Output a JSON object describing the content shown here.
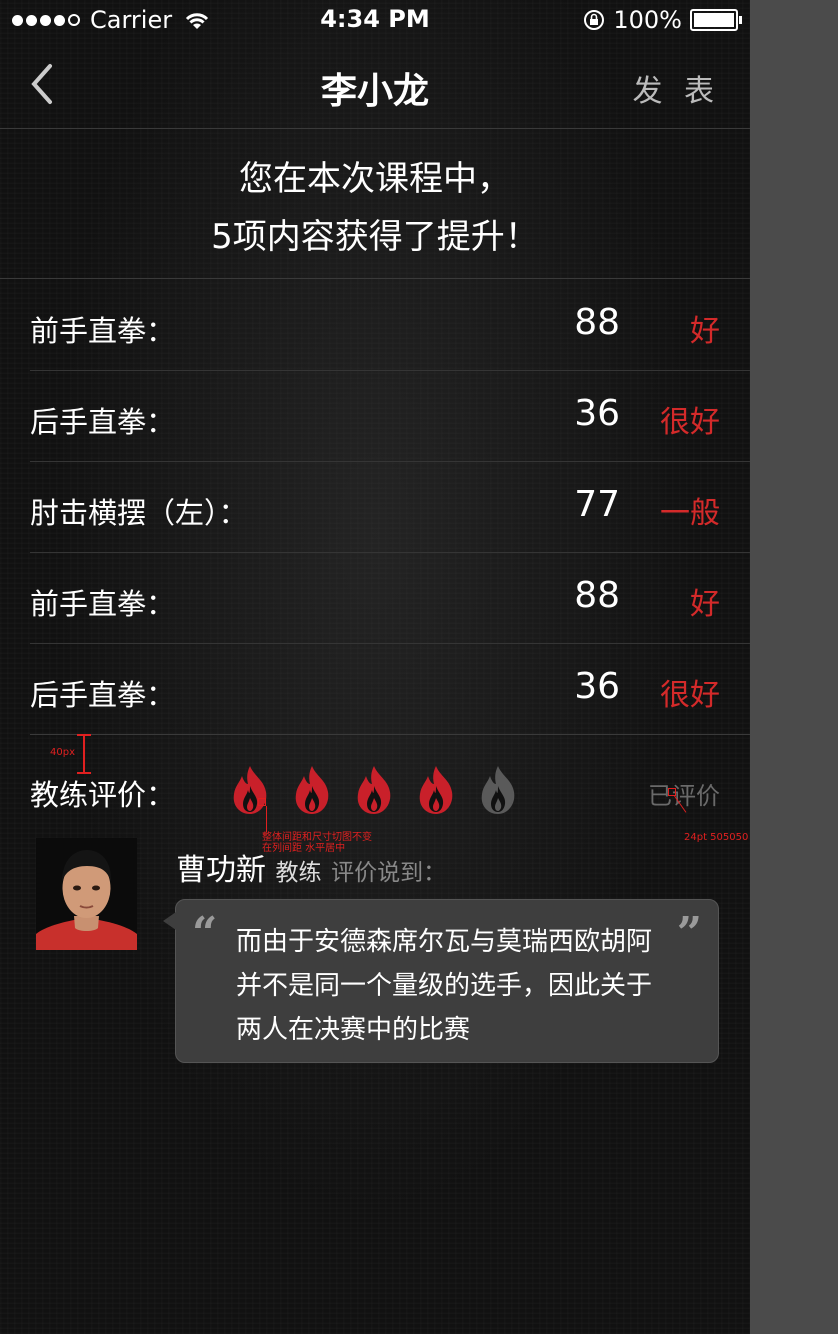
{
  "status_bar": {
    "carrier": "Carrier",
    "time": "4:34 PM",
    "battery": "100%"
  },
  "nav": {
    "title": "李小龙",
    "publish_label": "发 表"
  },
  "summary": {
    "line1": "您在本次课程中，",
    "line2": "5项内容获得了提升！"
  },
  "results": [
    {
      "label": "前手直拳：",
      "score": "88",
      "grade": "好"
    },
    {
      "label": "后手直拳：",
      "score": "36",
      "grade": "很好"
    },
    {
      "label": "肘击横摆（左）：",
      "score": "77",
      "grade": "一般"
    },
    {
      "label": "前手直拳：",
      "score": "88",
      "grade": "好"
    },
    {
      "label": "后手直拳：",
      "score": "36",
      "grade": "很好"
    }
  ],
  "coach_rating": {
    "label": "教练评价：",
    "rating": 4,
    "max": 5,
    "status": "已评价"
  },
  "annotations": {
    "spacing": "40px",
    "flame_note_1": "整体间距和尺寸切图不变",
    "flame_note_2": "在列间距 水平居中",
    "rated_note": "24pt 505050"
  },
  "coach_comment": {
    "name": "曹功新",
    "role": "教练",
    "said": "评价说到：",
    "text": "而由于安德森席尔瓦与莫瑞西欧胡阿并不是同一个量级的选手，因此关于两人在决赛中的比赛"
  },
  "colors": {
    "accent": "#d42a2a",
    "flame_inactive": "#5a5a5a",
    "rated": "#505050"
  }
}
